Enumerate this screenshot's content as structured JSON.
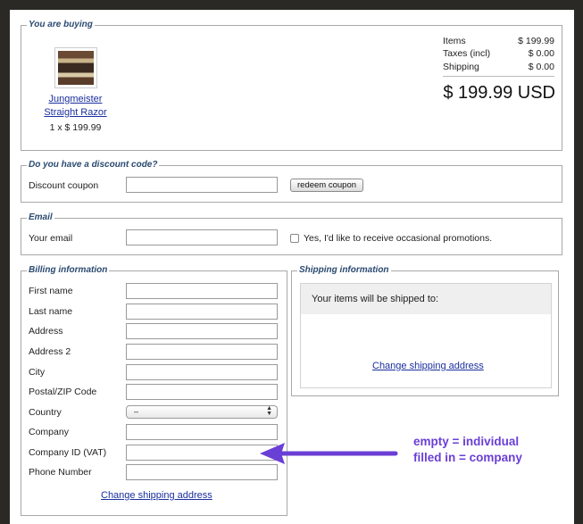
{
  "buying": {
    "legend": "You are buying",
    "product_name_line1": "Jungmeister",
    "product_name_line2": "Straight Razor",
    "quantity_price": "1 x $ 199.99",
    "summary": [
      {
        "label": "Items",
        "value": "$ 199.99"
      },
      {
        "label": "Taxes (incl)",
        "value": "$ 0.00"
      },
      {
        "label": "Shipping",
        "value": "$ 0.00"
      }
    ],
    "total": "$ 199.99 USD"
  },
  "discount": {
    "legend": "Do you have a discount code?",
    "label": "Discount coupon",
    "value": "",
    "button": "redeem coupon"
  },
  "email": {
    "legend": "Email",
    "label": "Your email",
    "value": "",
    "promo_label": "Yes, I'd like to receive occasional promotions.",
    "promo_checked": false
  },
  "billing": {
    "legend": "Billing information",
    "fields": {
      "first_name": "First name",
      "last_name": "Last name",
      "address": "Address",
      "address2": "Address 2",
      "city": "City",
      "postal": "Postal/ZIP Code",
      "country": "Country",
      "company": "Company",
      "company_id": "Company ID (VAT)",
      "phone": "Phone Number"
    },
    "country_selected": "–",
    "change_link": "Change shipping address"
  },
  "shipping": {
    "legend": "Shipping information",
    "shipped_to": "Your items will be shipped to:",
    "change_link": "Change shipping address"
  },
  "annotation": {
    "line1": "empty = individual",
    "line2": "filled in = company",
    "color": "#6a3fd6"
  }
}
